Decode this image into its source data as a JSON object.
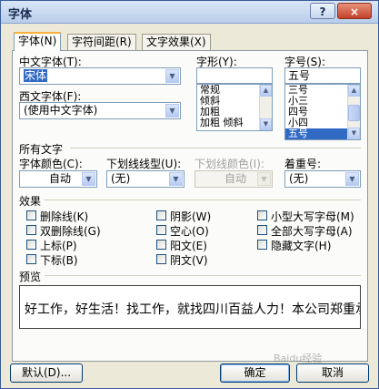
{
  "window": {
    "title": "字体",
    "help_glyph": "?",
    "close_glyph": "×"
  },
  "tabs": [
    {
      "label": "字体(N)",
      "active": true
    },
    {
      "label": "字符间距(R)",
      "active": false
    },
    {
      "label": "文字效果(X)",
      "active": false
    }
  ],
  "font": {
    "chinese_label": "中文字体(T):",
    "chinese_value": "宋体",
    "western_label": "西文字体(F):",
    "western_value": "(使用中文字体)",
    "style_label": "字形(Y):",
    "style_value": "",
    "style_items": [
      "常规",
      "倾斜",
      "加粗",
      "加粗 倾斜"
    ],
    "size_label": "字号(S):",
    "size_value": "五号",
    "size_items": [
      "三号",
      "小三",
      "四号",
      "小四",
      "五号"
    ],
    "size_selected": "五号"
  },
  "all_text": {
    "heading": "所有文字",
    "color_label": "字体颜色(C):",
    "color_value": "自动",
    "underline_label": "下划线线型(U):",
    "underline_value": "(无)",
    "underline_color_label": "下划线颜色(I):",
    "underline_color_value": "自动",
    "emphasis_label": "着重号:",
    "emphasis_value": "(无)"
  },
  "effects": {
    "heading": "效果",
    "col1": [
      "删除线(K)",
      "双删除线(G)",
      "上标(P)",
      "下标(B)"
    ],
    "col2": [
      "阴影(W)",
      "空心(O)",
      "阳文(E)",
      "阴文(V)"
    ],
    "col3": [
      "小型大写字母(M)",
      "全部大写字母(A)",
      "隐藏文字(H)"
    ]
  },
  "preview": {
    "heading": "预览",
    "text": "好工作，好生活！找工作，就找四川百益人力！本公司郑重承诺"
  },
  "buttons": {
    "default": "默认(D)...",
    "ok": "确定",
    "cancel": "取消"
  },
  "watermark": "Baidu经验"
}
